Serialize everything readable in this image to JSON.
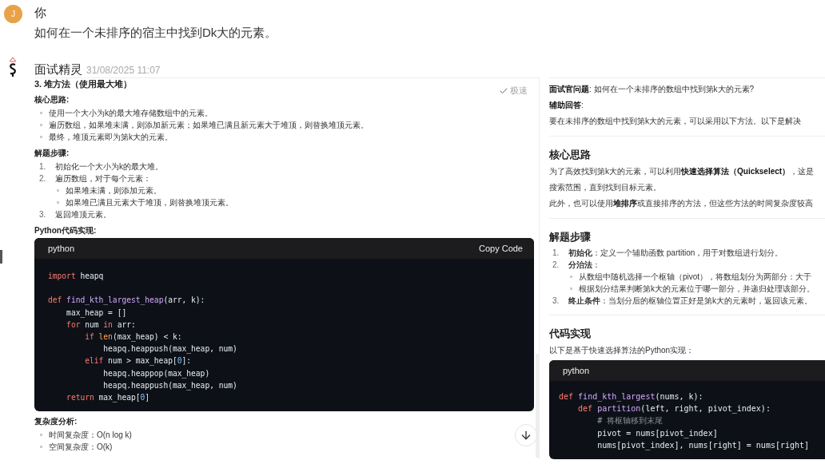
{
  "user_message": {
    "avatar_letter": "J",
    "author": "你",
    "text": "如何在一个未排序的宿主中找到Dk大的元素。"
  },
  "bot_message": {
    "author": "面试精灵",
    "timestamp": "31/08/2025 11:07"
  },
  "answer_panel": {
    "heading": "3. 堆方法（使用最大堆）",
    "speed_badge": "极速",
    "blocks": [
      {
        "kind": "label",
        "text": "核心思路:"
      },
      {
        "kind": "bullets",
        "items": [
          {
            "text": "使用一个大小为k的最大堆存储数组中的元素。"
          },
          {
            "text": "遍历数组，如果堆未满，则添加新元素；如果堆已满且新元素大于堆顶，则替换堆顶元素。"
          },
          {
            "text": "最终，堆顶元素即为第k大的元素。"
          }
        ]
      },
      {
        "kind": "label",
        "text": "解题步骤:"
      },
      {
        "kind": "steps",
        "items": [
          {
            "number": "1.",
            "text": "初始化一个大小为k的最大堆。"
          },
          {
            "number": "2.",
            "text": "遍历数组，对于每个元素：",
            "children": [
              {
                "text": "如果堆未满，则添加元素。"
              },
              {
                "text": "如果堆已满且元素大于堆顶，则替换堆顶元素。"
              }
            ]
          },
          {
            "number": "3.",
            "text": "返回堆顶元素。"
          }
        ]
      },
      {
        "kind": "label",
        "text": "Python代码实现:"
      },
      {
        "kind": "code",
        "language": "python",
        "copy_label": "Copy Code",
        "lines": [
          [
            {
              "kind": "keyword",
              "text": "import"
            },
            {
              "kind": "plain",
              "text": " heapq"
            }
          ],
          {
            "blank_before": true,
            "tokens": [
              {
                "kind": "keyword",
                "text": "def "
              },
              {
                "kind": "function",
                "text": "find_kth_largest_heap"
              },
              {
                "kind": "plain",
                "text": "(arr, k):"
              }
            ]
          },
          [
            {
              "kind": "plain",
              "text": "    max_heap = []"
            }
          ],
          [
            {
              "kind": "keyword",
              "text": "    for"
            },
            {
              "kind": "plain",
              "text": " num "
            },
            {
              "kind": "keyword",
              "text": "in"
            },
            {
              "kind": "plain",
              "text": " arr:"
            }
          ],
          [
            {
              "kind": "keyword",
              "text": "        if "
            },
            {
              "kind": "builtin",
              "text": "len"
            },
            {
              "kind": "plain",
              "text": "(max_heap) < k:"
            }
          ],
          [
            {
              "kind": "plain",
              "text": "            heapq.heappush(max_heap, num)"
            }
          ],
          [
            {
              "kind": "keyword",
              "text": "        elif"
            },
            {
              "kind": "plain",
              "text": " num > max_heap["
            },
            {
              "kind": "number",
              "text": "0"
            },
            {
              "kind": "plain",
              "text": "]:"
            }
          ],
          [
            {
              "kind": "plain",
              "text": "            heapq.heappop(max_heap)"
            }
          ],
          [
            {
              "kind": "plain",
              "text": "            heapq.heappush(max_heap, num)"
            }
          ],
          [
            {
              "kind": "keyword",
              "text": "    return"
            },
            {
              "kind": "plain",
              "text": " max_heap["
            },
            {
              "kind": "number",
              "text": "0"
            },
            {
              "kind": "plain",
              "text": "]"
            }
          ]
        ]
      },
      {
        "kind": "label",
        "text": "复杂度分析:"
      },
      {
        "kind": "bullets",
        "items": [
          {
            "text": "时间复杂度：O(n log k)"
          },
          {
            "text": "空间复杂度：O(k)"
          }
        ]
      }
    ]
  },
  "reference_panel": {
    "blocks": [
      {
        "kind": "paragraph",
        "text": "**面试官问题**: 如何在一个未排序的数组中找到第k大的元素?"
      },
      {
        "kind": "paragraph",
        "text": "**辅助回答**:"
      },
      {
        "kind": "paragraph",
        "text": "要在未排序的数组中找到第k大的元素，可以采用以下方法。以下是解决"
      },
      {
        "kind": "divider"
      },
      {
        "kind": "heading",
        "text": "核心思路"
      },
      {
        "kind": "paragraph",
        "text": "为了高效找到第k大的元素，可以利用**快速选择算法（Quickselect）**，这是"
      },
      {
        "kind": "paragraph",
        "text": "搜索范围，直到找到目标元素。"
      },
      {
        "kind": "paragraph",
        "text": "此外，也可以使用**堆排序**或直接排序的方法，但这些方法的时间复杂度较高"
      },
      {
        "kind": "divider"
      },
      {
        "kind": "heading",
        "text": "解题步骤"
      },
      {
        "kind": "steps",
        "items": [
          {
            "number": "1.",
            "text": "**初始化**：定义一个辅助函数 partition，用于对数组进行划分。"
          },
          {
            "number": "2.",
            "text": "**分治法**：",
            "children": [
              {
                "text": "从数组中随机选择一个枢轴（pivot），将数组划分为两部分：大于"
              },
              {
                "text": "根据划分结果判断第k大的元素位于哪一部分，并递归处理该部分。"
              }
            ]
          },
          {
            "number": "3.",
            "text": "**终止条件**：当划分后的枢轴位置正好是第k大的元素时，返回该元素。"
          }
        ]
      },
      {
        "kind": "divider"
      },
      {
        "kind": "heading",
        "text": "代码实现"
      },
      {
        "kind": "paragraph",
        "text": "以下是基于快速选择算法的Python实现："
      },
      {
        "kind": "code",
        "language": "python",
        "lines": [
          [
            {
              "kind": "keyword",
              "text": "def "
            },
            {
              "kind": "function",
              "text": "find_kth_largest"
            },
            {
              "kind": "plain",
              "text": "(nums, k):"
            }
          ],
          [
            {
              "kind": "keyword",
              "text": "    def "
            },
            {
              "kind": "function",
              "text": "partition"
            },
            {
              "kind": "plain",
              "text": "(left, right, pivot_index):"
            }
          ],
          [
            {
              "kind": "comment",
              "text": "        # 将枢轴移到末尾"
            }
          ],
          [
            {
              "kind": "plain",
              "text": "        pivot = nums[pivot_index]"
            }
          ],
          [
            {
              "kind": "plain",
              "text": "        nums[pivot_index], nums[right] = nums[right]"
            }
          ]
        ]
      }
    ]
  }
}
